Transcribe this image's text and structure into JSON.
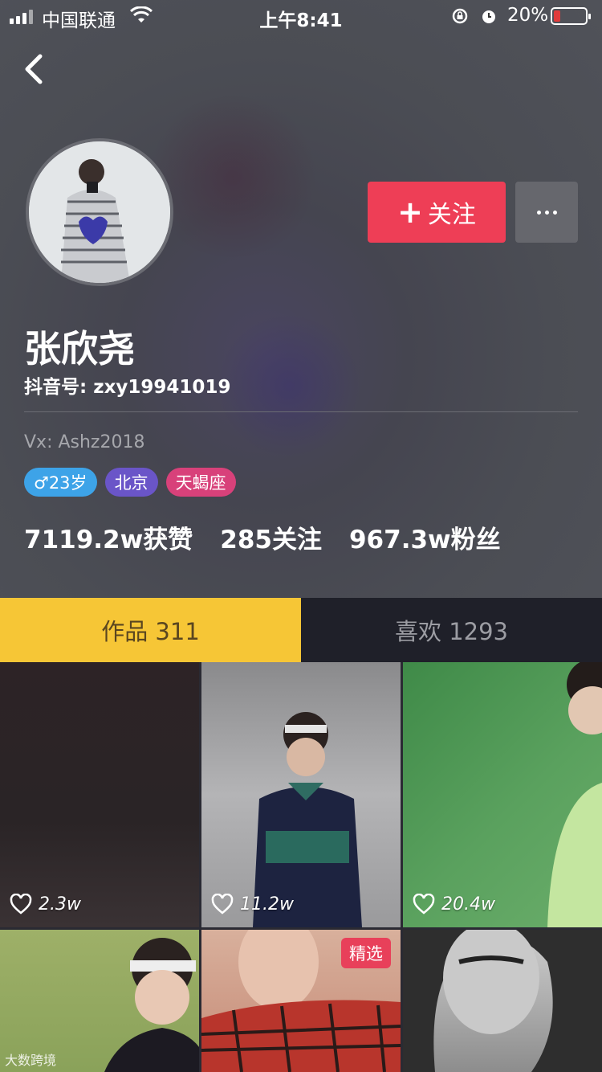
{
  "status_bar": {
    "carrier": "中国联通",
    "time": "上午8:41",
    "battery": "20%"
  },
  "profile": {
    "follow_label": "关注",
    "nickname": "张欣尧",
    "douyin_id": "抖音号: zxy19941019",
    "bio": "Vx: Ashz2018",
    "tags": {
      "age": "♂23岁",
      "city": "北京",
      "zodiac": "天蝎座"
    },
    "stats": {
      "likes": "7119.2w获赞",
      "following": "285关注",
      "followers": "967.3w粉丝"
    }
  },
  "tabs": {
    "works": "作品 311",
    "likes": "喜欢 1293"
  },
  "videos": [
    {
      "likes": "2.3w"
    },
    {
      "likes": "11.2w"
    },
    {
      "likes": "20.4w"
    },
    {
      "badge": ""
    },
    {
      "badge": "精选"
    },
    {
      "badge": ""
    }
  ],
  "watermark": "大数跨境",
  "colors": {
    "follow": "#ee3e56",
    "active_tab": "#f6c636",
    "background": "#4b4d54"
  }
}
